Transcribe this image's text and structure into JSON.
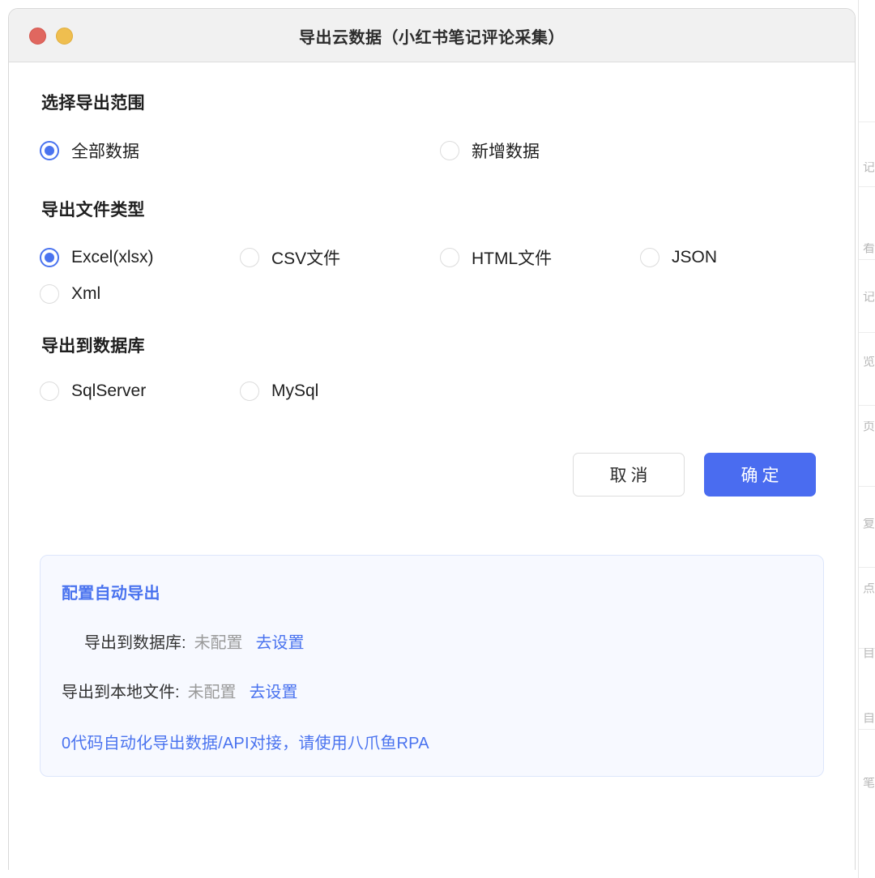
{
  "window": {
    "title": "导出云数据（小红书笔记评论采集）",
    "traffic_lights": [
      {
        "name": "close",
        "color": "#e0675f"
      },
      {
        "name": "minimize",
        "color": "#efbe4f"
      }
    ]
  },
  "scope": {
    "heading": "选择导出范围",
    "options": [
      {
        "label": "全部数据",
        "selected": true
      },
      {
        "label": "新增数据",
        "selected": false
      }
    ]
  },
  "file_type": {
    "heading": "导出文件类型",
    "options": [
      {
        "label": "Excel(xlsx)",
        "selected": true
      },
      {
        "label": "CSV文件",
        "selected": false
      },
      {
        "label": "HTML文件",
        "selected": false
      },
      {
        "label": "JSON",
        "selected": false
      },
      {
        "label": "Xml",
        "selected": false
      }
    ]
  },
  "database": {
    "heading": "导出到数据库",
    "options": [
      {
        "label": "SqlServer",
        "selected": false
      },
      {
        "label": "MySql",
        "selected": false
      }
    ]
  },
  "actions": {
    "cancel": "取消",
    "confirm": "确定"
  },
  "auto_export": {
    "title": "配置自动导出",
    "rows": [
      {
        "label": "导出到数据库:",
        "value": "未配置",
        "link": "去设置"
      },
      {
        "label": "导出到本地文件:",
        "value": "未配置",
        "link": "去设置"
      }
    ],
    "footer": "0代码自动化导出数据/API对接，请使用八爪鱼RPA"
  },
  "colors": {
    "accent": "#4a6cf0",
    "link": "#4a73ef",
    "info_bg": "#f7f9ff",
    "info_border": "#dde6fb",
    "titlebar_bg": "#f1f1f1"
  }
}
